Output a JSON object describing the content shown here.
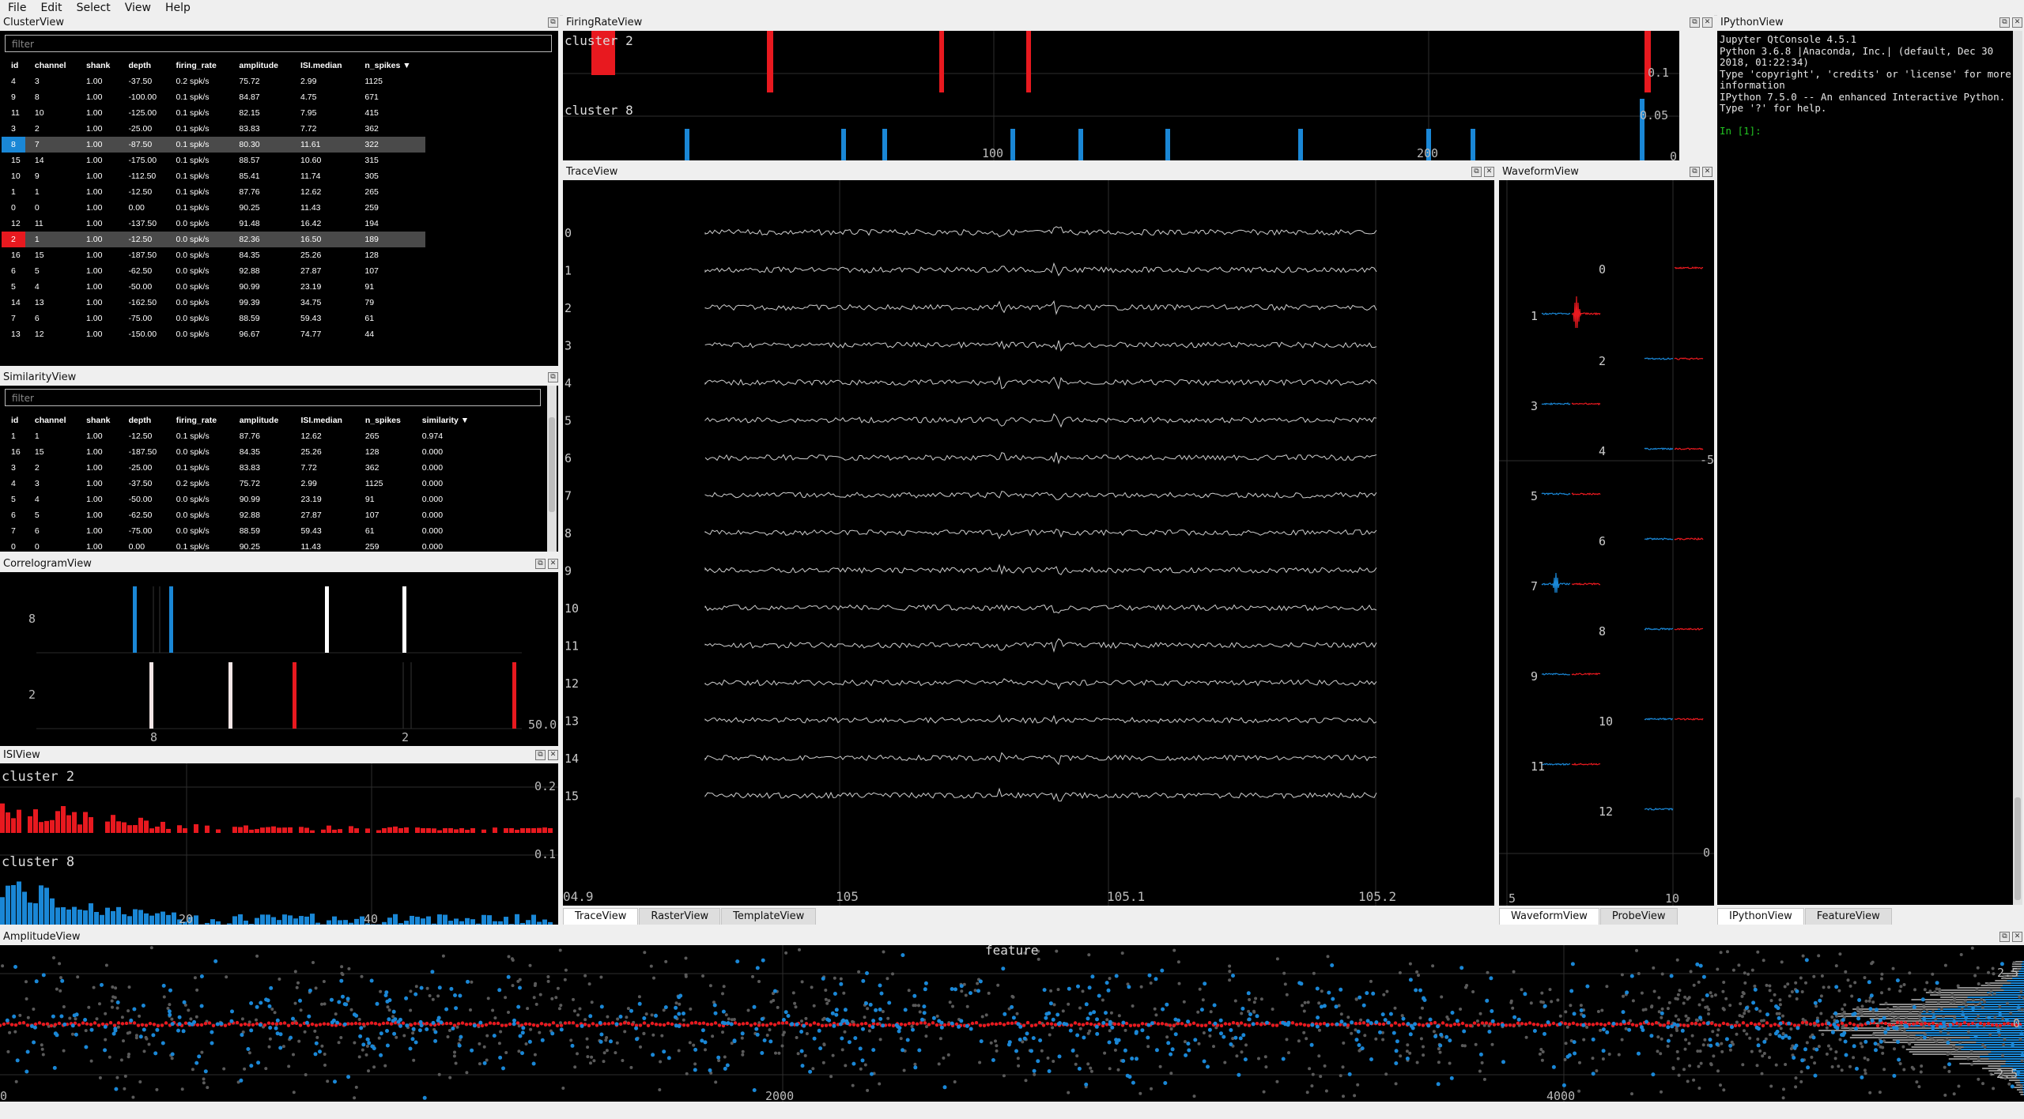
{
  "menu": [
    "File",
    "Edit",
    "Select",
    "View",
    "Help"
  ],
  "colors": {
    "selected_1": "#1a87d6",
    "selected_2": "#e8191f",
    "bg": "#000000"
  },
  "cluster_view": {
    "title": "ClusterView",
    "filter_placeholder": "filter",
    "columns": [
      "id",
      "channel",
      "shank",
      "depth",
      "firing_rate",
      "amplitude",
      "ISI.median",
      "n_spikes ▼"
    ],
    "rows": [
      [
        "4",
        "3",
        "1.00",
        "-37.50",
        "0.2 spk/s",
        "75.72",
        "2.99",
        "1125"
      ],
      [
        "9",
        "8",
        "1.00",
        "-100.00",
        "0.1 spk/s",
        "84.87",
        "4.75",
        "671"
      ],
      [
        "11",
        "10",
        "1.00",
        "-125.00",
        "0.1 spk/s",
        "82.15",
        "7.95",
        "415"
      ],
      [
        "3",
        "2",
        "1.00",
        "-25.00",
        "0.1 spk/s",
        "83.83",
        "7.72",
        "362"
      ],
      [
        "8",
        "7",
        "1.00",
        "-87.50",
        "0.1 spk/s",
        "80.30",
        "11.61",
        "322"
      ],
      [
        "15",
        "14",
        "1.00",
        "-175.00",
        "0.1 spk/s",
        "88.57",
        "10.60",
        "315"
      ],
      [
        "10",
        "9",
        "1.00",
        "-112.50",
        "0.1 spk/s",
        "85.41",
        "11.74",
        "305"
      ],
      [
        "1",
        "1",
        "1.00",
        "-12.50",
        "0.1 spk/s",
        "87.76",
        "12.62",
        "265"
      ],
      [
        "0",
        "0",
        "1.00",
        "0.00",
        "0.1 spk/s",
        "90.25",
        "11.43",
        "259"
      ],
      [
        "12",
        "11",
        "1.00",
        "-137.50",
        "0.0 spk/s",
        "91.48",
        "16.42",
        "194"
      ],
      [
        "2",
        "1",
        "1.00",
        "-12.50",
        "0.0 spk/s",
        "82.36",
        "16.50",
        "189"
      ],
      [
        "16",
        "15",
        "1.00",
        "-187.50",
        "0.0 spk/s",
        "84.35",
        "25.26",
        "128"
      ],
      [
        "6",
        "5",
        "1.00",
        "-62.50",
        "0.0 spk/s",
        "92.88",
        "27.87",
        "107"
      ],
      [
        "5",
        "4",
        "1.00",
        "-50.00",
        "0.0 spk/s",
        "90.99",
        "23.19",
        "91"
      ],
      [
        "14",
        "13",
        "1.00",
        "-162.50",
        "0.0 spk/s",
        "99.39",
        "34.75",
        "79"
      ],
      [
        "7",
        "6",
        "1.00",
        "-75.00",
        "0.0 spk/s",
        "88.59",
        "59.43",
        "61"
      ],
      [
        "13",
        "12",
        "1.00",
        "-150.00",
        "0.0 spk/s",
        "96.67",
        "74.77",
        "44"
      ]
    ]
  },
  "similarity_view": {
    "title": "SimilarityView",
    "filter_placeholder": "filter",
    "columns": [
      "id",
      "channel",
      "shank",
      "depth",
      "firing_rate",
      "amplitude",
      "ISI.median",
      "n_spikes",
      "similarity ▼"
    ],
    "rows": [
      [
        "1",
        "1",
        "1.00",
        "-12.50",
        "0.1 spk/s",
        "87.76",
        "12.62",
        "265",
        "0.974"
      ],
      [
        "16",
        "15",
        "1.00",
        "-187.50",
        "0.0 spk/s",
        "84.35",
        "25.26",
        "128",
        "0.000"
      ],
      [
        "3",
        "2",
        "1.00",
        "-25.00",
        "0.1 spk/s",
        "83.83",
        "7.72",
        "362",
        "0.000"
      ],
      [
        "4",
        "3",
        "1.00",
        "-37.50",
        "0.2 spk/s",
        "75.72",
        "2.99",
        "1125",
        "0.000"
      ],
      [
        "5",
        "4",
        "1.00",
        "-50.00",
        "0.0 spk/s",
        "90.99",
        "23.19",
        "91",
        "0.000"
      ],
      [
        "6",
        "5",
        "1.00",
        "-62.50",
        "0.0 spk/s",
        "92.88",
        "27.87",
        "107",
        "0.000"
      ],
      [
        "7",
        "6",
        "1.00",
        "-75.00",
        "0.0 spk/s",
        "88.59",
        "59.43",
        "61",
        "0.000"
      ],
      [
        "0",
        "0",
        "1.00",
        "0.00",
        "0.1 spk/s",
        "90.25",
        "11.43",
        "259",
        "0.000"
      ]
    ]
  },
  "correlogram_view": {
    "title": "CorrelogramView",
    "row_labels": [
      "8",
      "2"
    ],
    "col_labels": [
      "8",
      "2"
    ],
    "corner_label": "50.0"
  },
  "isi_view": {
    "title": "ISIView",
    "series_labels": [
      "cluster 2",
      "cluster 8"
    ],
    "y_ticks": [
      "0.2",
      "0.1"
    ],
    "x_ticks": [
      "20",
      "40"
    ]
  },
  "firing_rate_view": {
    "title": "FiringRateView",
    "series_labels": [
      "cluster 2",
      "cluster 8"
    ],
    "y_ticks": [
      "0.1",
      "0.05"
    ],
    "x_ticks": [
      "100",
      "200"
    ],
    "corner_label": "0"
  },
  "trace_view": {
    "title": "TraceView",
    "channels": [
      "0",
      "1",
      "2",
      "3",
      "4",
      "5",
      "6",
      "7",
      "8",
      "9",
      "10",
      "11",
      "12",
      "13",
      "14",
      "15"
    ],
    "x_ticks": [
      "04.9",
      "105",
      "105.1",
      "105.2"
    ]
  },
  "waveform_view": {
    "title": "WaveformView",
    "channels": [
      "0",
      "1",
      "2",
      "3",
      "4",
      "5",
      "6",
      "7",
      "8",
      "9",
      "10",
      "11",
      "12"
    ],
    "x_ticks": [
      "5",
      "10"
    ],
    "y_ticks": [
      "-5",
      "0"
    ]
  },
  "ipython_view": {
    "title": "IPythonView",
    "lines": [
      "Jupyter QtConsole 4.5.1",
      "Python 3.6.8 |Anaconda, Inc.| (default, Dec 30",
      "2018, 01:22:34)",
      "Type 'copyright', 'credits' or 'license' for more",
      "information",
      "IPython 7.5.0 -- An enhanced Interactive Python.",
      "Type '?' for help."
    ],
    "prompt": "In [1]:"
  },
  "tabs_center": [
    "TraceView",
    "RasterView",
    "TemplateView"
  ],
  "tabs_waveform": [
    "WaveformView",
    "ProbeView"
  ],
  "tabs_right": [
    "IPythonView",
    "FeatureView"
  ],
  "amplitude_view": {
    "title": "AmplitudeView",
    "plot_label": "feature",
    "x_ticks": [
      "0",
      "2000",
      "4000"
    ],
    "y_ticks": [
      "2.5",
      "0",
      "-2.5"
    ]
  }
}
